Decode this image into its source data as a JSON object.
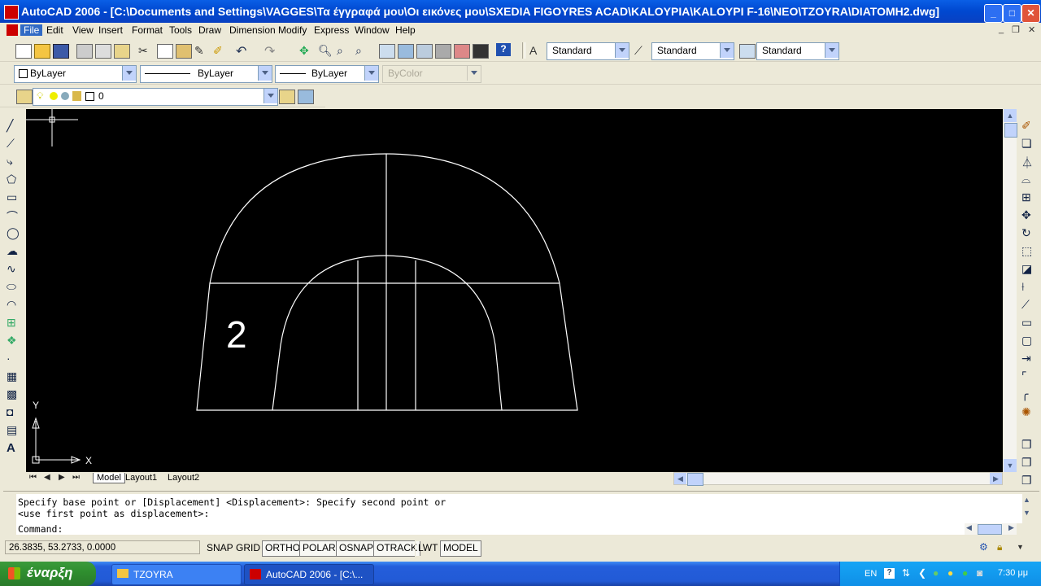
{
  "window": {
    "title": "AutoCAD 2006 - [C:\\Documents and Settings\\VAGGES\\Τα έγγραφά μου\\Οι εικόνες μου\\SXEDIA FIGOYRES ACAD\\KALOYPIA\\KALOYPI F-16\\NEO\\TZOYRA\\DIATOMH2.dwg]",
    "minimize": "_",
    "maximize": "□",
    "close": "✕"
  },
  "menus": [
    "File",
    "Edit",
    "View",
    "Insert",
    "Format",
    "Tools",
    "Draw",
    "Dimension",
    "Modify",
    "Express",
    "Window",
    "Help"
  ],
  "styles": {
    "text_style": "Standard",
    "dim_style": "Standard",
    "table_style": "Standard"
  },
  "properties": {
    "color": "ByLayer",
    "linetype": "ByLayer",
    "lineweight": "ByLayer",
    "plotstyle": "ByColor"
  },
  "layer": {
    "current": "0"
  },
  "drawing": {
    "label": "2",
    "ucs_x": "X",
    "ucs_y": "Y"
  },
  "layout_tabs": [
    "Model",
    "Layout1",
    "Layout2"
  ],
  "command": {
    "history_line1": "Specify base point or [Displacement] <Displacement>: Specify second point or",
    "history_line2": "<use first point as displacement>:",
    "prompt": "Command:"
  },
  "status": {
    "coords": "26.3835, 53.2733, 0.0000",
    "buttons": [
      "SNAP",
      "GRID",
      "ORTHO",
      "POLAR",
      "OSNAP",
      "OTRACK",
      "LWT",
      "MODEL"
    ]
  },
  "taskbar": {
    "start": "έναρξη",
    "tasks": [
      "TZOYRA",
      "AutoCAD 2006 - [C:\\..."
    ],
    "lang": "EN",
    "clock": "7:30 μμ"
  },
  "colors": {
    "canvas": "#000000",
    "drawing_lines": "#ffffff",
    "titlebar": "#0a5fe6",
    "taskbar": "#245edb",
    "start": "#2f8f2f"
  }
}
